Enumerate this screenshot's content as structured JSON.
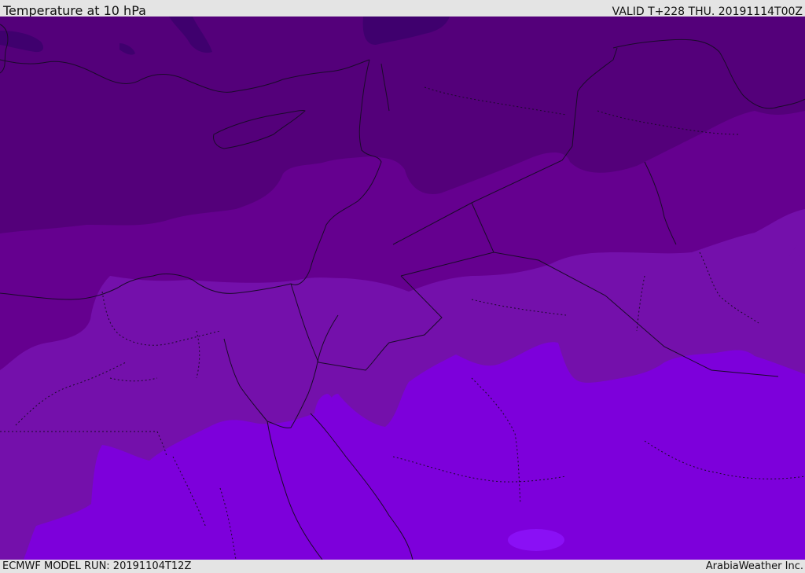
{
  "header": {
    "title": "Temperature at 10 hPa",
    "valid_time": "VALID T+228 THU. 20191114T00Z"
  },
  "footer": {
    "model_run": "ECMWF MODEL RUN: 20191104T12Z",
    "credit": "ArabiaWeather Inc."
  },
  "map": {
    "field": "temperature",
    "level": "10 hPa",
    "colors": {
      "band_darkest": "#3f006e",
      "band_1": "#54007a",
      "band_2": "#65008f",
      "band_3": "#7410ab",
      "band_4": "#7d00db",
      "band_warm_spot": "#8a10f5",
      "coastline": "#1a0a2a",
      "border": "#1a0a2a"
    }
  }
}
